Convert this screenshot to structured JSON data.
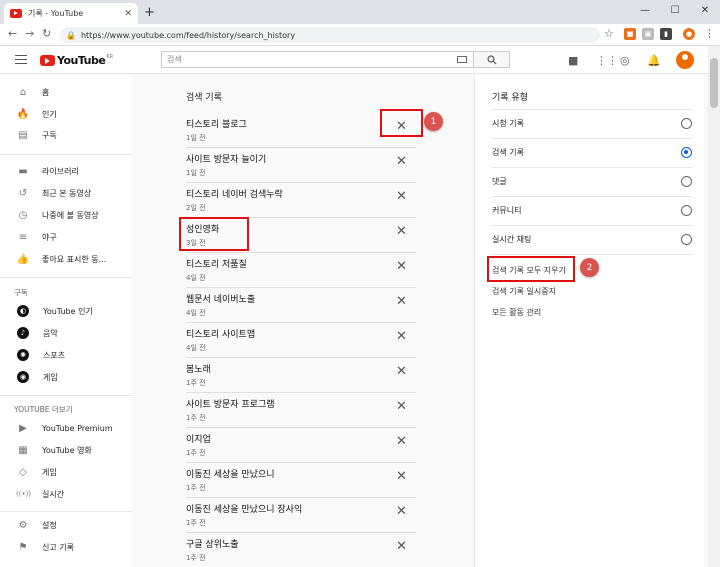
{
  "browser": {
    "tab_title": "기록 - YouTube",
    "tab_close": "✕",
    "new_tab": "+",
    "url": "https://www.youtube.com/feed/history/search_history",
    "win_min": "—",
    "win_max": "☐",
    "win_close": "✕"
  },
  "header": {
    "logo": "YouTube",
    "region": "KR",
    "search_placeholder": "검색"
  },
  "sidebar": {
    "top": [
      {
        "icon": "home-icon",
        "glyph": "⌂",
        "label": "홈"
      },
      {
        "icon": "flame-icon",
        "glyph": "🔥",
        "label": "인기"
      },
      {
        "icon": "subscriptions-icon",
        "glyph": "▤",
        "label": "구독"
      }
    ],
    "library": [
      {
        "icon": "library-icon",
        "glyph": "▬",
        "label": "라이브러리"
      },
      {
        "icon": "history-icon",
        "glyph": "↺",
        "label": "최근 본 동영상"
      },
      {
        "icon": "clock-icon",
        "glyph": "◷",
        "label": "나중에 볼 동영상"
      },
      {
        "icon": "playlist-icon",
        "glyph": "≡",
        "label": "야구"
      },
      {
        "icon": "thumbs-up-icon",
        "glyph": "👍",
        "label": "좋아요 표시한 동..."
      }
    ],
    "subs_title": "구독",
    "subs": [
      {
        "icon": "youtube-popular-icon",
        "glyph": "◐",
        "label": "YouTube 인기"
      },
      {
        "icon": "music-icon",
        "glyph": "♪",
        "label": "음악"
      },
      {
        "icon": "sports-icon",
        "glyph": "✺",
        "label": "스포츠"
      },
      {
        "icon": "gaming-icon",
        "glyph": "◉",
        "label": "게임"
      }
    ],
    "more_title": "YOUTUBE 더보기",
    "more": [
      {
        "icon": "youtube-premium-icon",
        "glyph": "▶",
        "label": "YouTube Premium"
      },
      {
        "icon": "film-icon",
        "glyph": "▦",
        "label": "YouTube 영화"
      },
      {
        "icon": "gamepad-icon",
        "glyph": "◇",
        "label": "게임"
      },
      {
        "icon": "live-icon",
        "glyph": "((•))",
        "label": "실시간"
      }
    ],
    "settings": [
      {
        "icon": "gear-icon",
        "glyph": "⚙",
        "label": "설정"
      },
      {
        "icon": "flag-icon",
        "glyph": "⚑",
        "label": "신고 기록"
      }
    ]
  },
  "main": {
    "title": "검색 기록",
    "items": [
      {
        "query": "티스토리 블로그",
        "time": "1일 전"
      },
      {
        "query": "사이트 방문자 늘이기",
        "time": "1일 전"
      },
      {
        "query": "티스토리 네이버 검색누락",
        "time": "2일 전"
      },
      {
        "query": "성인영화",
        "time": "3일 전"
      },
      {
        "query": "티스토리 저품질",
        "time": "4일 전"
      },
      {
        "query": "웹문서 네이버노출",
        "time": "4일 전"
      },
      {
        "query": "티스토리 사이트맵",
        "time": "4일 전"
      },
      {
        "query": "봄노래",
        "time": "1주 전"
      },
      {
        "query": "사이트 방문자 프로그램",
        "time": "1주 전"
      },
      {
        "query": "이지업",
        "time": "1주 전"
      },
      {
        "query": "이동진 세상을 만났으니",
        "time": "1주 전"
      },
      {
        "query": "이동진 세상을 만났으니 장사익",
        "time": "1주 전"
      },
      {
        "query": "구글 상위노출",
        "time": "1주 전"
      }
    ]
  },
  "panel": {
    "title": "기록 유형",
    "options": [
      {
        "label": "시청 기록",
        "selected": false
      },
      {
        "label": "검색 기록",
        "selected": true
      },
      {
        "label": "댓글",
        "selected": false
      },
      {
        "label": "커뮤니티",
        "selected": false
      },
      {
        "label": "실시간 채팅",
        "selected": false
      }
    ],
    "clear_all": "검색 기록 모두 지우기",
    "pause": "검색 기록 일시중지",
    "manage": "모든 활동 관리"
  },
  "annotations": {
    "badge1": "1",
    "badge2": "2"
  },
  "colors": {
    "accent": "#065fd4",
    "brand": "#e62117",
    "annotation": "#dd1111"
  }
}
